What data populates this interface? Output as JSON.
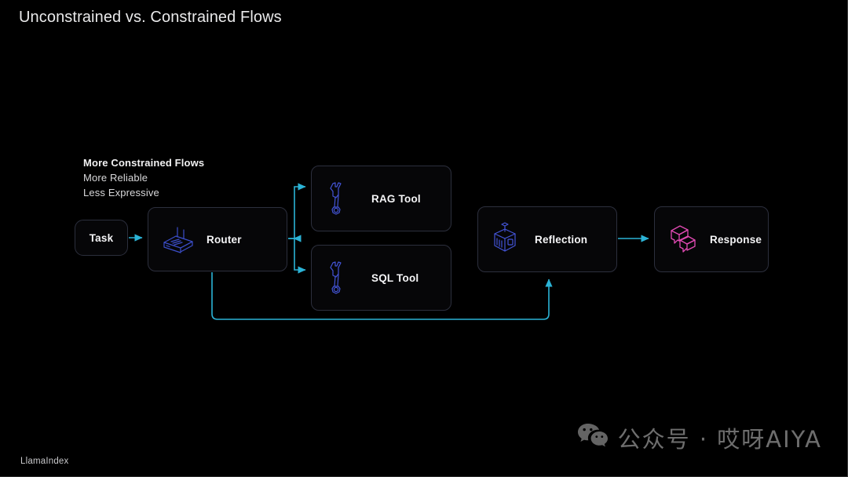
{
  "slide": {
    "title": "Unconstrained vs. Constrained Flows",
    "background_color": "#000000",
    "accent_arrow_color": "#2bb3d6",
    "node_border_color": "#2c2f3d"
  },
  "caption": {
    "heading": "More Constrained Flows",
    "line1": "More Reliable",
    "line2": "Less Expressive"
  },
  "nodes": {
    "task": {
      "label": "Task",
      "icon": "none"
    },
    "router": {
      "label": "Router",
      "icon": "router-icon",
      "icon_color": "#3b4ec9"
    },
    "rag_tool": {
      "label": "RAG Tool",
      "icon": "wrench-icon",
      "icon_color": "#4354d6"
    },
    "sql_tool": {
      "label": "SQL Tool",
      "icon": "wrench-icon",
      "icon_color": "#4354d6"
    },
    "reflection": {
      "label": "Reflection",
      "icon": "cube-icon",
      "icon_color": "#4354d6"
    },
    "response": {
      "label": "Response",
      "icon": "speech-bubbles-icon",
      "icon_color": "#e24ab4"
    }
  },
  "footer": {
    "brand": "LlamaIndex",
    "watermark_text": "公众号 · 哎呀AIYA",
    "watermark_icon": "wechat-icon"
  }
}
